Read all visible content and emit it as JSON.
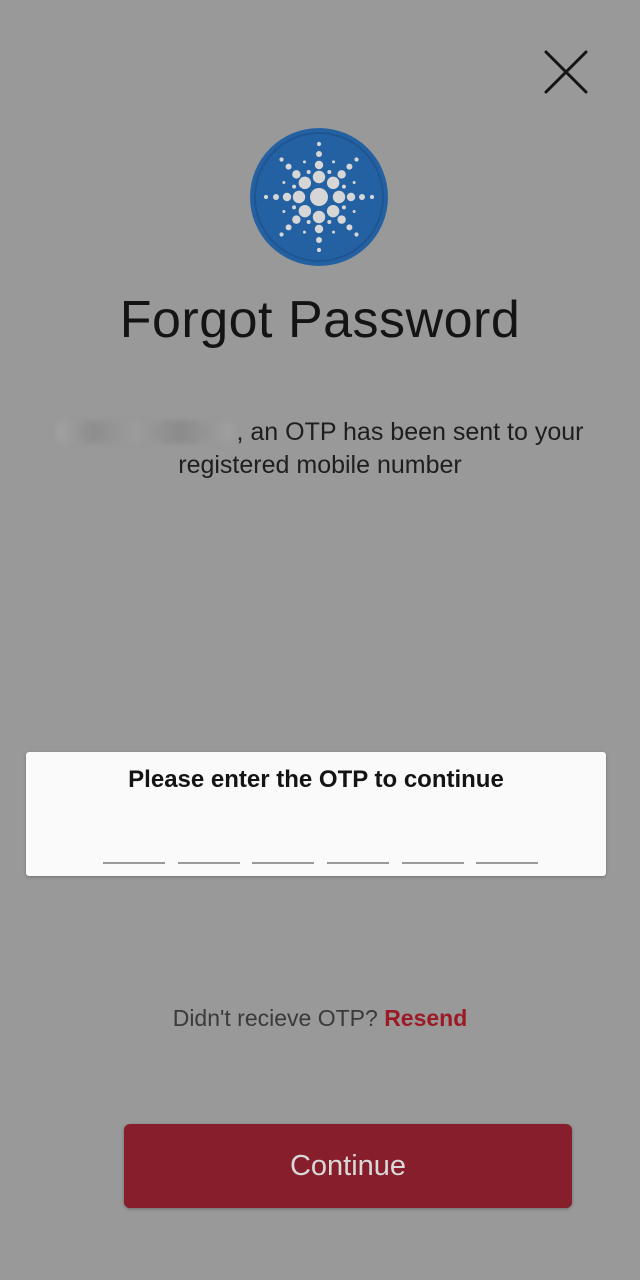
{
  "header": {
    "close_icon": "close-icon",
    "logo_icon": "starburst-logo-icon",
    "title": "Forgot Password"
  },
  "message": {
    "text": ", an OTP has been sent to your registered mobile number"
  },
  "otp": {
    "label": "Please enter the OTP to continue",
    "digits": [
      "",
      "",
      "",
      "",
      "",
      ""
    ]
  },
  "resend": {
    "prompt": "Didn't recieve OTP?",
    "link": "Resend"
  },
  "continue_label": "Continue",
  "colors": {
    "overlay": "#999999",
    "accent": "#9b1a26",
    "button": "#861e2b",
    "logo": "#2461a3"
  }
}
